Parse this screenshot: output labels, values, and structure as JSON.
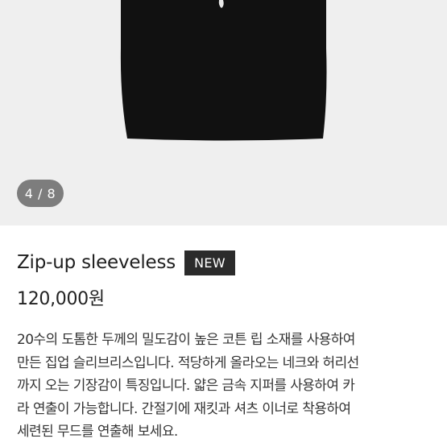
{
  "gallery": {
    "page_indicator": "4 / 8",
    "image_subject": "black-sleeveless-top"
  },
  "product": {
    "name": "Zip-up sleeveless",
    "badge": "NEW",
    "price": "120,000원",
    "description_lines": [
      "20수의 도톰한 두께의 밀도감이 높은 코튼 립 소재를 사용하여",
      "만든 집업 슬리브리스입니다. 적당하게 올라오는 네크와 허리선",
      "까지 오는 기장감이 특징입니다. 얇은 금속 지퍼를 사용하여 카",
      "라 연출이 가능합니다. 간절기에 재킷과 셔츠 이너로 착용하여",
      "세련된 무드를 연출해 보세요."
    ]
  },
  "colors": {
    "gallery_bg": "#efefef",
    "garment": "#111111",
    "indicator_bg": "#7d7d7d",
    "badge_bg": "#2b2b2b"
  }
}
